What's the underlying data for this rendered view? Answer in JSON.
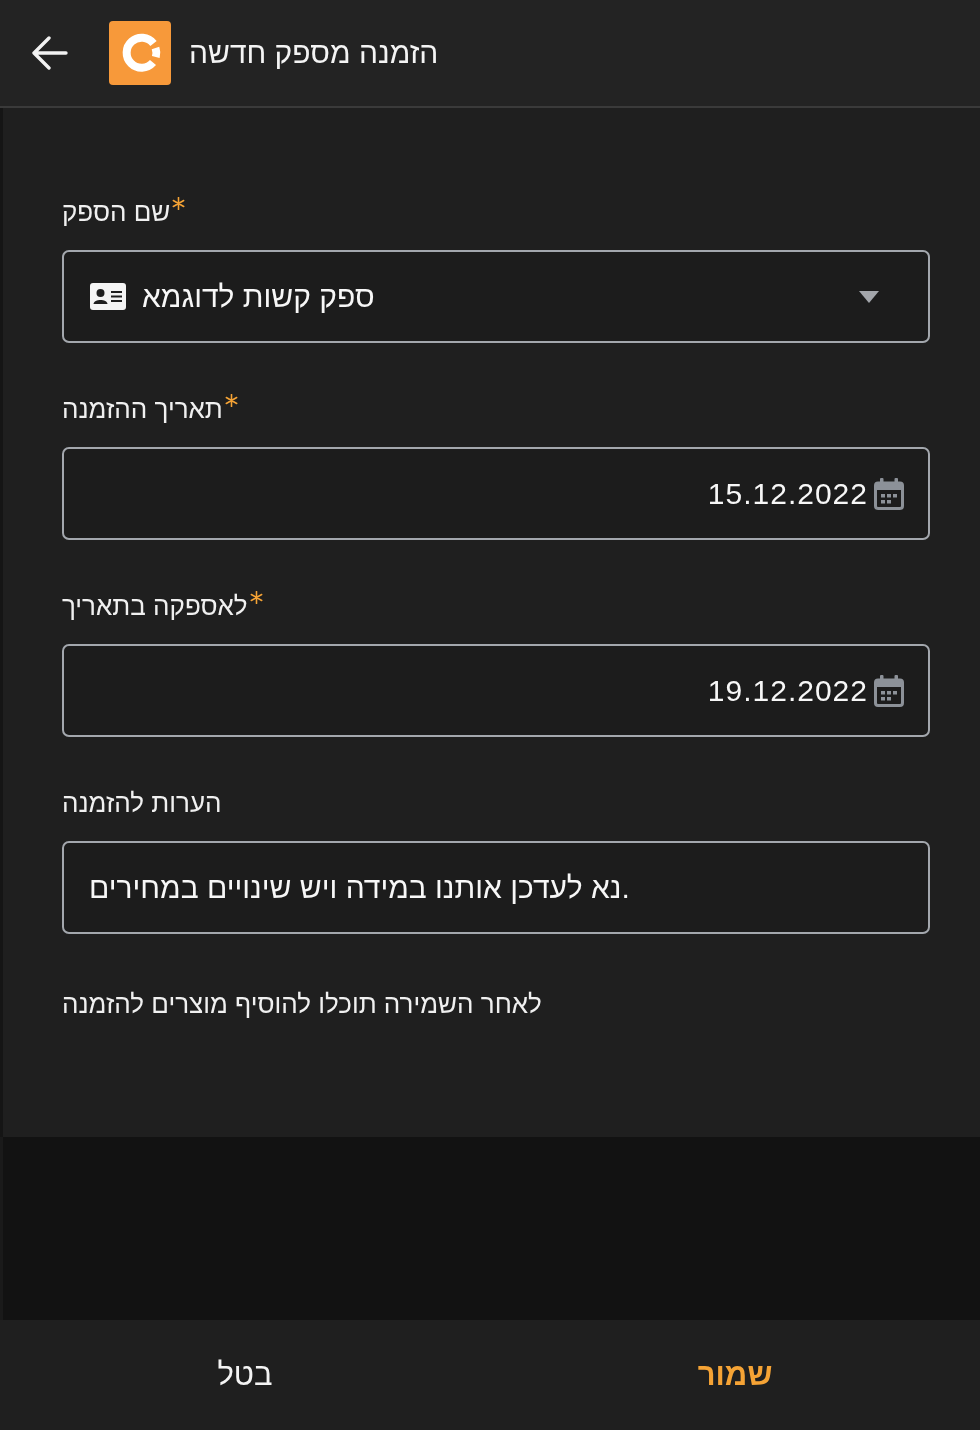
{
  "header": {
    "title": "הזמנה מספק חדשה"
  },
  "form": {
    "fields": [
      {
        "kind": "select",
        "label": "שם הספק",
        "required": true,
        "value": "ספק קשות לדוגמא"
      },
      {
        "kind": "date",
        "label": "תאריך ההזמנה",
        "required": true,
        "value": "15.12.2022"
      },
      {
        "kind": "date",
        "label": "לאספקה בתאריך",
        "required": true,
        "value": "19.12.2022"
      },
      {
        "kind": "text",
        "label": "הערות להזמנה",
        "required": false,
        "value": "נא לעדכן אותנו במידה ויש שינויים במחירים."
      }
    ],
    "hint": "לאחר השמירה תוכלו להוסיף מוצרים להזמנה"
  },
  "footer": {
    "buttons": [
      {
        "kind": "primary",
        "label": "שמור"
      },
      {
        "kind": "cancel",
        "label": "בטל"
      }
    ]
  }
}
